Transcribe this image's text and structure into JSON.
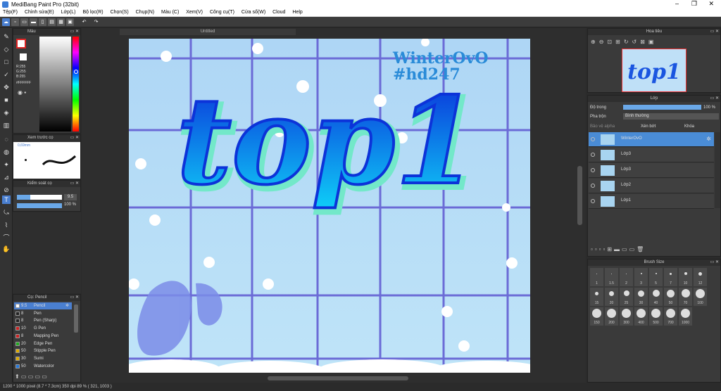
{
  "app": {
    "title": "MediBang Paint Pro (32bit)"
  },
  "menu": [
    "Tệp(F)",
    "Chỉnh sửa(E)",
    "Lớp(L)",
    "Bộ lọc(R)",
    "Chọn(S)",
    "Chụp(N)",
    "Màu (C)",
    "Xem(V)",
    "Công cụ(T)",
    "Cửa sổ(W)",
    "Cloud",
    "Help"
  ],
  "color_panel": {
    "title": "Màu",
    "r": "R:255",
    "g": "G:255",
    "b": "B:255",
    "hex": "#FFFFFF"
  },
  "brush_preview": {
    "title": "Xem trước cọ",
    "size": "0,69mm"
  },
  "brush_control": {
    "title": "Kiểm soát cọ",
    "size_value": "9.5",
    "opacity_value": "100 %",
    "size_level": 0.3,
    "opacity_level": 1.0
  },
  "brush_list": {
    "title": "Cọ: Pencil",
    "items": [
      {
        "size": "9.5",
        "name": "Pencil",
        "color": "#ffffff",
        "selected": true
      },
      {
        "size": "8",
        "name": "Pen",
        "color": "#222222"
      },
      {
        "size": "8",
        "name": "Pen (Sharp)",
        "color": "#222222"
      },
      {
        "size": "10",
        "name": "G Pen",
        "color": "#cc2222"
      },
      {
        "size": "8",
        "name": "Mapping Pen",
        "color": "#cc2222"
      },
      {
        "size": "20",
        "name": "Edge Pen",
        "color": "#22aa22"
      },
      {
        "size": "50",
        "name": "Stipple Pen",
        "color": "#ddaa00"
      },
      {
        "size": "30",
        "name": "Sumi",
        "color": "#ddaa00"
      },
      {
        "size": "50",
        "name": "Watercolor",
        "color": "#2277dd"
      }
    ]
  },
  "canvas": {
    "tab": "Untitled",
    "text_top": "WinterOvO",
    "text_tag": "#hd247",
    "art": "top1"
  },
  "navigator": {
    "title": "Hoa tiêu"
  },
  "layers": {
    "title": "Lớp",
    "opacity_label": "Độ trong",
    "opacity_value": "100 %",
    "blend_label": "Pha trộn",
    "blend_value": "Bình thường",
    "protect_alpha": "Bảo vệ alpha",
    "clipping": "Xén bớt",
    "lock": "Khóa",
    "items": [
      {
        "name": "WinterOvO",
        "selected": true
      },
      {
        "name": "Lớp3"
      },
      {
        "name": "Lớp3"
      },
      {
        "name": "Lớp2"
      },
      {
        "name": "Lớp1"
      }
    ]
  },
  "brush_size": {
    "title": "Brush Size",
    "sizes": [
      "1",
      "1.5",
      "2",
      "3",
      "5",
      "7",
      "10",
      "12",
      "15",
      "20",
      "25",
      "30",
      "40",
      "50",
      "70",
      "100",
      "150",
      "200",
      "300",
      "400",
      "500",
      "700",
      "1000"
    ]
  },
  "status": {
    "text": "1200 * 1000 pixel   (8.7 * 7.3cm)  350 dpi   89 %   ( 321, 1003 )"
  }
}
